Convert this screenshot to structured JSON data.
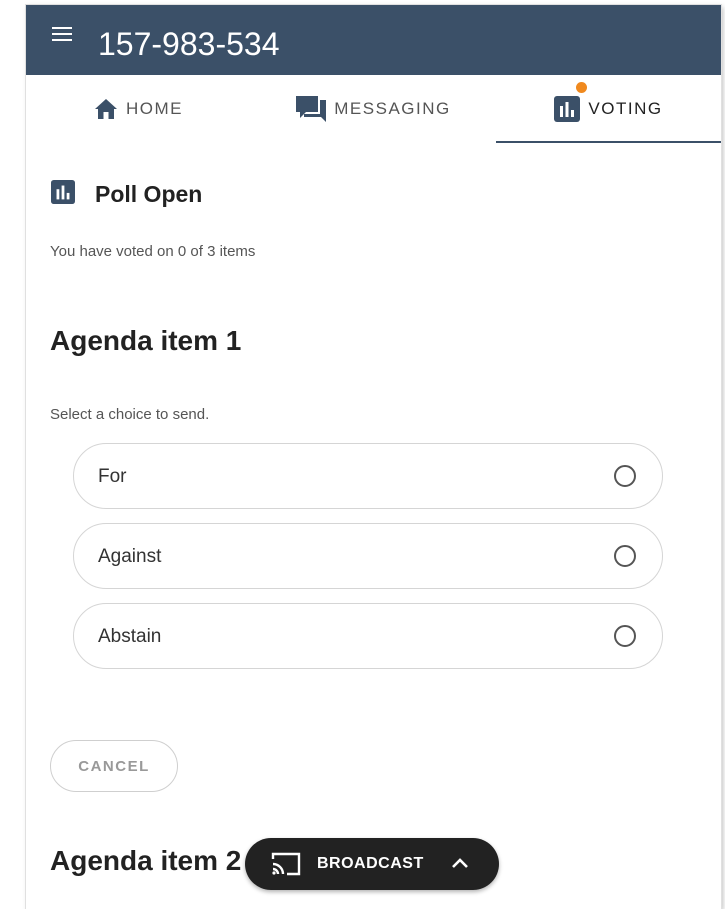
{
  "header": {
    "title": "157-983-534"
  },
  "tabs": [
    {
      "label": "HOME",
      "icon": "home-icon"
    },
    {
      "label": "MESSAGING",
      "icon": "chat-icon"
    },
    {
      "label": "VOTING",
      "icon": "poll-icon",
      "active": true,
      "has_notification": true
    }
  ],
  "poll": {
    "status": "Poll Open",
    "progress_text": "You have voted on 0 of 3 items"
  },
  "agenda_item": {
    "title": "Agenda item 1",
    "hint": "Select a choice to send.",
    "choices": [
      {
        "label": "For",
        "selected": false
      },
      {
        "label": "Against",
        "selected": false
      },
      {
        "label": "Abstain",
        "selected": false
      }
    ],
    "cancel_label": "CANCEL"
  },
  "next_agenda_item": {
    "title": "Agenda item 2"
  },
  "broadcast": {
    "label": "BROADCAST",
    "icon": "cast-icon"
  },
  "colors": {
    "header_bg": "#3b5068",
    "accent_dot": "#f0891e",
    "broadcast_bg": "#222222"
  }
}
